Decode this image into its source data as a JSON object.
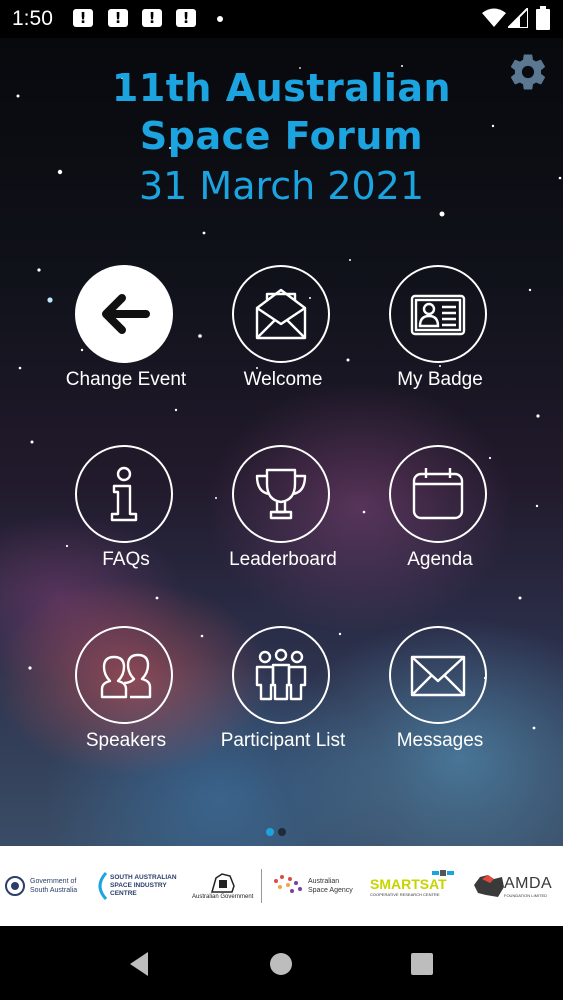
{
  "status_bar": {
    "time": "1:50",
    "notification_count": 4,
    "notification_glyph": "!"
  },
  "header": {
    "title_line1": "11th Australian",
    "title_line2": "Space Forum",
    "date": "31 March 2021",
    "settings_icon": "gear-icon",
    "accent_color": "#1ba4e0"
  },
  "tiles": [
    {
      "label": "Change Event",
      "icon": "arrow-left-icon"
    },
    {
      "label": "Welcome",
      "icon": "open-envelope-icon"
    },
    {
      "label": "My Badge",
      "icon": "id-badge-icon"
    },
    {
      "label": "FAQs",
      "icon": "info-icon"
    },
    {
      "label": "Leaderboard",
      "icon": "trophy-icon"
    },
    {
      "label": "Agenda",
      "icon": "calendar-icon"
    },
    {
      "label": "Speakers",
      "icon": "people-icon"
    },
    {
      "label": "Participant List",
      "icon": "group-icon"
    },
    {
      "label": "Messages",
      "icon": "envelope-icon"
    }
  ],
  "pager": {
    "pages": 2,
    "active_index": 0
  },
  "sponsors": [
    {
      "line1": "Government of",
      "line2": "South Australia"
    },
    {
      "line1": "SOUTH AUSTRALIAN",
      "line2": "SPACE INDUSTRY",
      "line3": "CENTRE"
    },
    {
      "line1": "Australian Government"
    },
    {
      "line1": "Australian",
      "line2": "Space Agency"
    },
    {
      "name": "SMARTSAT",
      "sub": "COOPERATIVE RESEARCH CENTRE"
    },
    {
      "name": "AMDA",
      "sub": "FOUNDATION LIMITED"
    }
  ]
}
